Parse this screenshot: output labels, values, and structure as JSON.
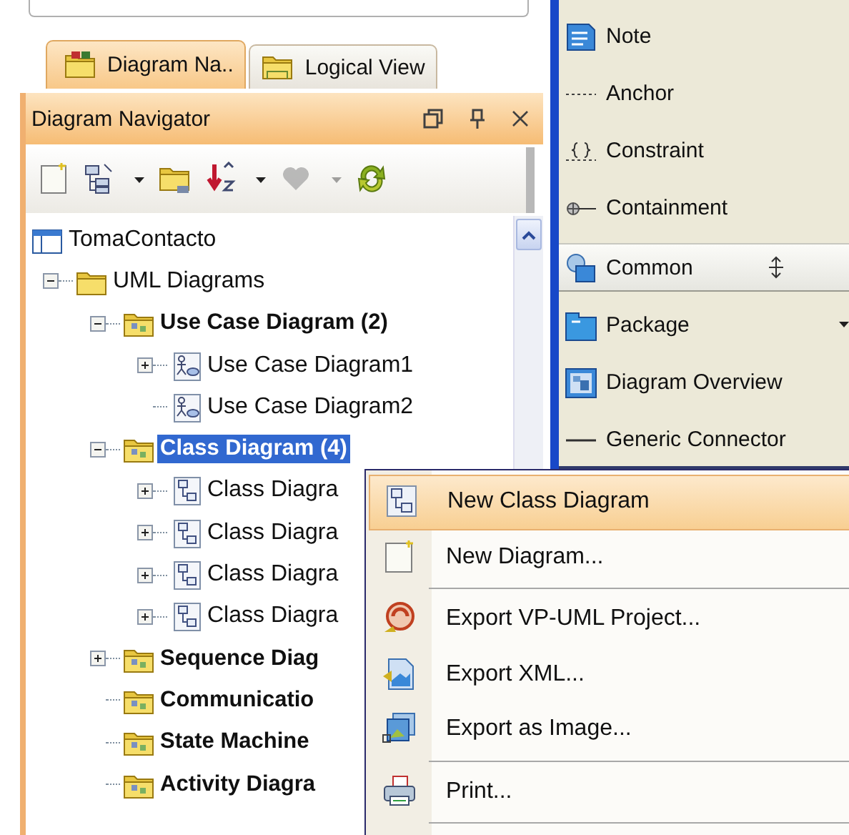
{
  "tabs": [
    {
      "label": "Diagram Na..",
      "kind": "diagrams",
      "selected": true
    },
    {
      "label": "Logical View",
      "kind": "logical",
      "selected": false
    }
  ],
  "navigator": {
    "title": "Diagram Navigator",
    "toolbar": [
      {
        "kind": "new",
        "dropdown": false,
        "disabled": false
      },
      {
        "kind": "layout",
        "dropdown": true,
        "disabled": false
      },
      {
        "kind": "folder",
        "dropdown": false,
        "disabled": false
      },
      {
        "kind": "sort",
        "dropdown": true,
        "disabled": false
      },
      {
        "kind": "favorite",
        "dropdown": true,
        "disabled": true
      },
      {
        "kind": "refresh",
        "dropdown": false,
        "disabled": false
      }
    ],
    "tree": [
      {
        "label": "TomaContacto",
        "kind": "project",
        "selected": false,
        "children": [
          {
            "label": "UML Diagrams",
            "kind": "folder",
            "expanded": true,
            "selected": false,
            "children": [
              {
                "label": "Use Case Diagram (2)",
                "kind": "category",
                "expanded": true,
                "selected": false,
                "children": [
                  {
                    "label": "Use Case Diagram1",
                    "kind": "usecase",
                    "expanded": false,
                    "selected": false
                  },
                  {
                    "label": "Use Case Diagram2",
                    "kind": "usecase",
                    "selected": false
                  }
                ]
              },
              {
                "label": "Class Diagram (4)",
                "kind": "category",
                "expanded": true,
                "selected": true,
                "children": [
                  {
                    "label": "Class Diagra",
                    "kind": "class",
                    "expanded": false,
                    "selected": false
                  },
                  {
                    "label": "Class Diagra",
                    "kind": "class",
                    "expanded": false,
                    "selected": false
                  },
                  {
                    "label": "Class Diagra",
                    "kind": "class",
                    "expanded": false,
                    "selected": false
                  },
                  {
                    "label": "Class Diagra",
                    "kind": "class",
                    "expanded": false,
                    "selected": false
                  }
                ]
              },
              {
                "label": "Sequence Diag",
                "kind": "category",
                "expanded": false,
                "selected": false
              },
              {
                "label": "Communicatio",
                "kind": "category",
                "selected": false
              },
              {
                "label": "State Machine",
                "kind": "category",
                "selected": false
              },
              {
                "label": "Activity Diagra",
                "kind": "category",
                "selected": false
              }
            ]
          }
        ]
      }
    ]
  },
  "palette": [
    {
      "label": "Note",
      "kind": "note",
      "dropdown": false
    },
    {
      "label": "Anchor",
      "kind": "anchor",
      "dropdown": false
    },
    {
      "label": "Constraint",
      "kind": "constraint",
      "dropdown": false
    },
    {
      "label": "Containment",
      "kind": "containment",
      "dropdown": false
    },
    {
      "label": "Common",
      "kind": "group",
      "dropdown": false
    },
    {
      "label": "Package",
      "kind": "package",
      "dropdown": true
    },
    {
      "label": "Diagram Overview",
      "kind": "overview",
      "dropdown": false
    },
    {
      "label": "Generic Connector",
      "kind": "connector",
      "dropdown": false
    }
  ],
  "context_menu": {
    "groups": [
      [
        {
          "label": "New Class Diagram",
          "kind": "class",
          "selected": true
        },
        {
          "label": "New Diagram...",
          "kind": "new",
          "selected": false
        }
      ],
      [
        {
          "label": "Export VP-UML Project...",
          "kind": "project",
          "selected": false
        },
        {
          "label": "Export XML...",
          "kind": "xml",
          "selected": false
        },
        {
          "label": "Export as Image...",
          "kind": "image",
          "selected": false
        }
      ],
      [
        {
          "label": "Print...",
          "kind": "print",
          "selected": false
        }
      ]
    ]
  }
}
